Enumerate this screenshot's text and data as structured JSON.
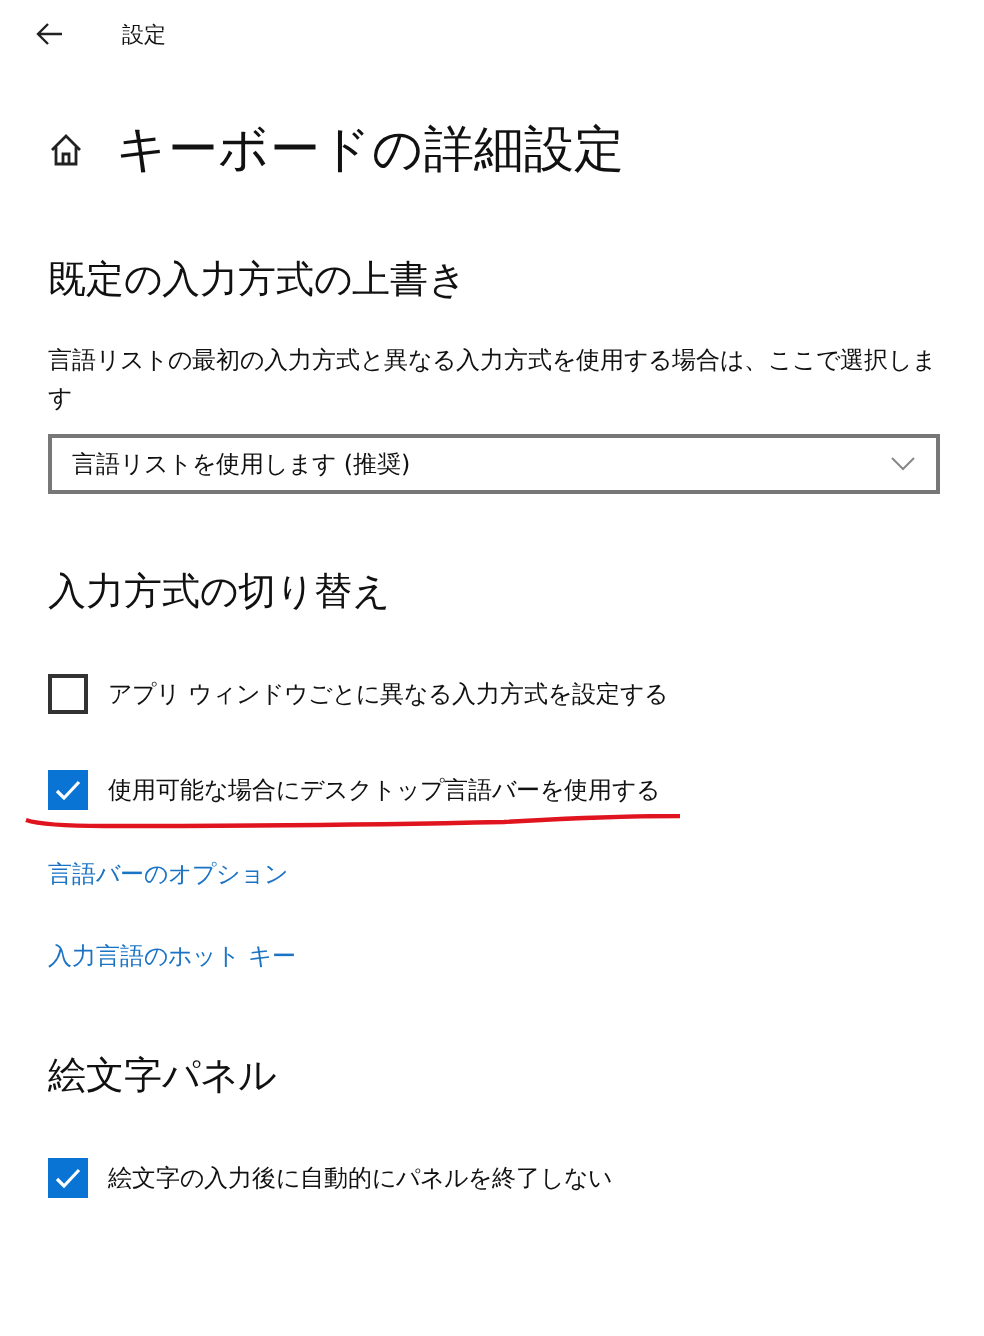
{
  "window": {
    "title": "設定"
  },
  "page_title": "キーボードの詳細設定",
  "sections": [
    {
      "heading": "既定の入力方式の上書き",
      "items": [
        {
          "kind": "text",
          "label": "言語リストの最初の入力方式と異なる入力方式を使用する場合は、ここで選択します"
        },
        {
          "kind": "dropdown",
          "label": "言語リストを使用します (推奨)"
        }
      ]
    },
    {
      "heading": "入力方式の切り替え",
      "items": [
        {
          "kind": "checkbox",
          "label": "アプリ ウィンドウごとに異なる入力方式を設定する",
          "checked": false,
          "underlined": false
        },
        {
          "kind": "checkbox",
          "label": "使用可能な場合にデスクトップ言語バーを使用する",
          "checked": true,
          "underlined": true
        },
        {
          "kind": "link",
          "label": "言語バーのオプション"
        },
        {
          "kind": "link",
          "label": "入力言語のホット キー"
        }
      ]
    },
    {
      "heading": "絵文字パネル",
      "items": [
        {
          "kind": "checkbox",
          "label": "絵文字の入力後に自動的にパネルを終了しない",
          "checked": true,
          "underlined": false
        }
      ]
    }
  ]
}
